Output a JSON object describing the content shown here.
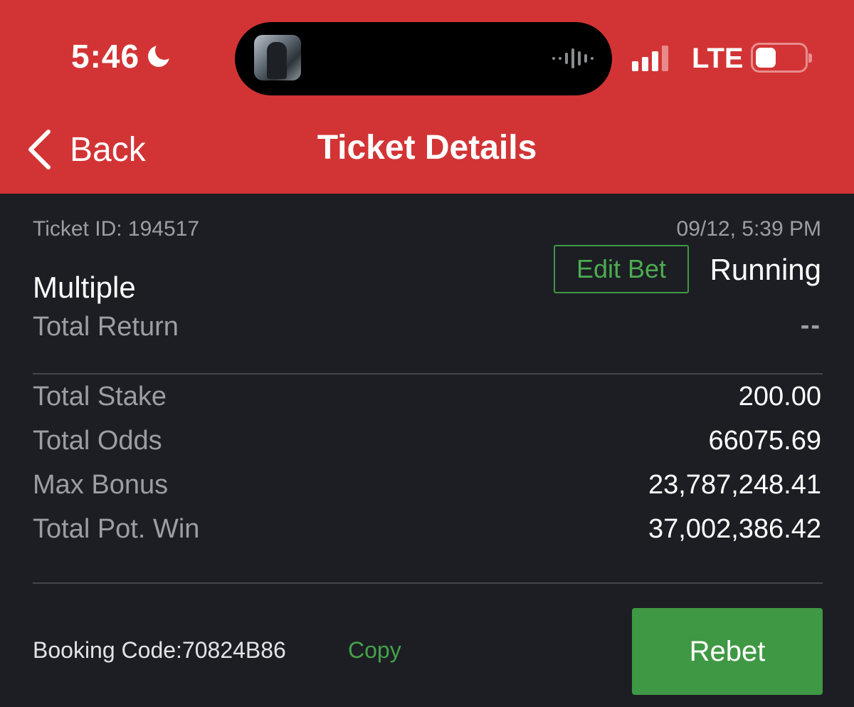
{
  "status_bar": {
    "time": "5:46",
    "network": "LTE",
    "icons": [
      "moon-icon",
      "album-art",
      "waveform-icon",
      "signal-icon",
      "battery-icon"
    ]
  },
  "nav": {
    "back_label": "Back",
    "title": "Ticket Details"
  },
  "ticket": {
    "id_text": "Ticket ID: 194517",
    "datetime": "09/12, 5:39 PM",
    "edit_label": "Edit Bet",
    "status": "Running",
    "bet_type": "Multiple",
    "total_return_label": "Total Return",
    "total_return_value": "--"
  },
  "summary_rows": [
    {
      "label": "Total Stake",
      "value": "200.00"
    },
    {
      "label": "Total Odds",
      "value": "66075.69"
    },
    {
      "label": "Max Bonus",
      "value": "23,787,248.41"
    },
    {
      "label": "Total Pot. Win",
      "value": "37,002,386.42"
    }
  ],
  "footer": {
    "booking_code": "Booking Code:70824B86",
    "copy_label": "Copy",
    "rebet_label": "Rebet"
  },
  "colors": {
    "header_bg": "#d23435",
    "body_bg": "#1c1e24",
    "accent_green": "#3f9843",
    "muted_text": "#9c9ea3"
  }
}
